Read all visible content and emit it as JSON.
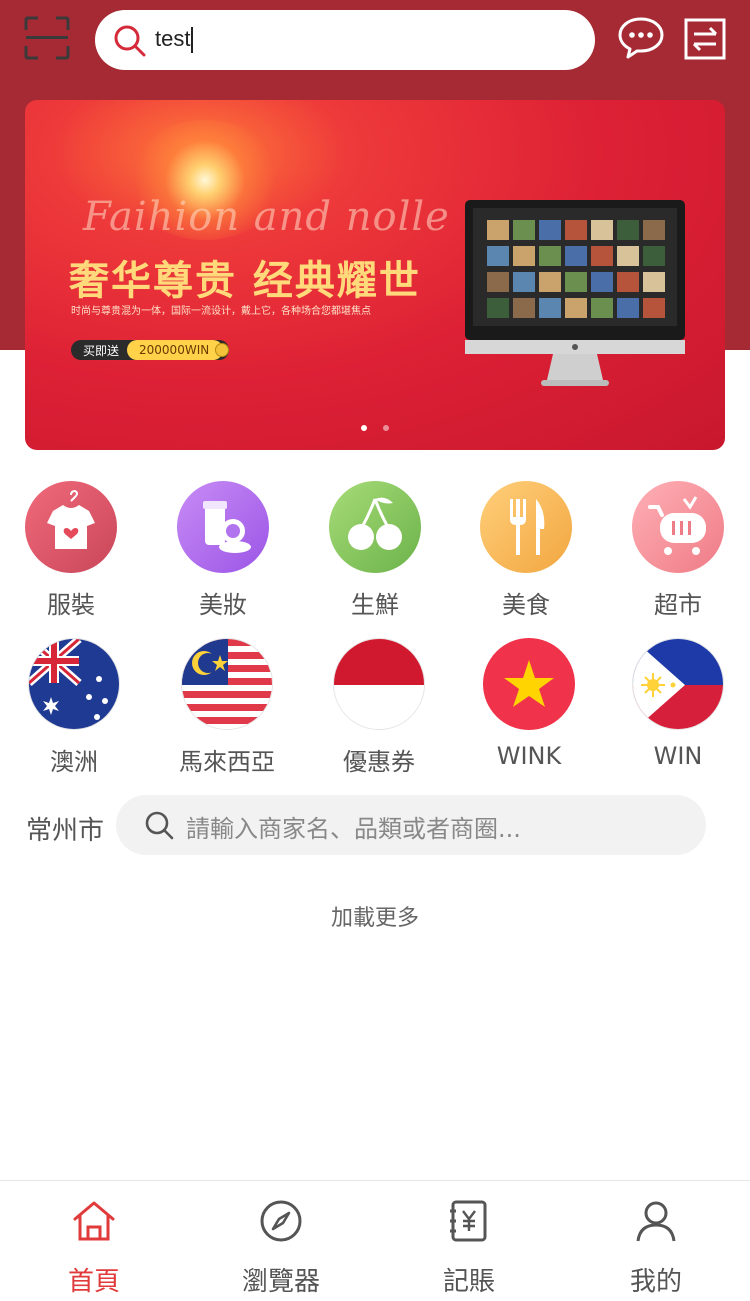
{
  "colors": {
    "brand": "#a52a33",
    "accent": "#e03a3a",
    "tab_active": "#e03a3a",
    "tab_inactive": "#555555"
  },
  "header": {
    "search_value": "test",
    "icons": [
      "scan-icon",
      "search-icon",
      "chat-icon",
      "swap-icon"
    ]
  },
  "banner": {
    "script_text": "Faihion and nolle",
    "title": "奢华尊贵 经典耀世",
    "subtitle": "时尚与尊贵混为一体，国际一流设计，戴上它，各种场合您都堪焦点",
    "pill_key": "买即送",
    "pill_value": "200000WIN",
    "page_index": 0,
    "page_count": 2
  },
  "categories": [
    {
      "label": "服裝",
      "icon": "clothing-icon"
    },
    {
      "label": "美妝",
      "icon": "cosmetics-icon"
    },
    {
      "label": "生鮮",
      "icon": "cherry-icon"
    },
    {
      "label": "美食",
      "icon": "fork-knife-icon"
    },
    {
      "label": "超市",
      "icon": "shopping-cart-icon"
    }
  ],
  "regions": [
    {
      "label": "澳洲",
      "icon": "australia-flag-icon"
    },
    {
      "label": "馬來西亞",
      "icon": "malaysia-flag-icon"
    },
    {
      "label": "優惠券",
      "icon": "indonesia-flag-icon"
    },
    {
      "label": "WINK",
      "icon": "vietnam-flag-icon"
    },
    {
      "label": "WIN",
      "icon": "philippines-flag-icon"
    }
  ],
  "merchant_search": {
    "city": "常州市",
    "placeholder": "請輸入商家名、品類或者商圈..."
  },
  "load_more": "加載更多",
  "tabs": [
    {
      "label": "首頁",
      "icon": "home-icon",
      "active": true
    },
    {
      "label": "瀏覽器",
      "icon": "compass-icon",
      "active": false
    },
    {
      "label": "記賬",
      "icon": "ledger-icon",
      "active": false
    },
    {
      "label": "我的",
      "icon": "user-icon",
      "active": false
    }
  ]
}
